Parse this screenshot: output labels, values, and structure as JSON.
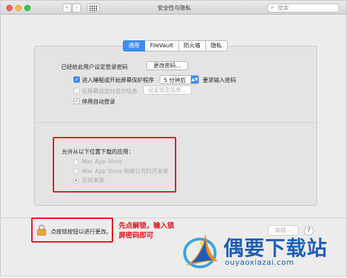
{
  "window": {
    "title": "安全性与隐私",
    "search_placeholder": "搜索",
    "grid_icon": "grid-icon"
  },
  "tabs": [
    {
      "label": "通用",
      "active": true
    },
    {
      "label": "FileVault",
      "active": false
    },
    {
      "label": "防火墙",
      "active": false
    },
    {
      "label": "隐私",
      "active": false
    }
  ],
  "general": {
    "login_password_label": "已经给此用户设定登录密码",
    "change_password_button": "更改密码...",
    "require_password": {
      "label": "进入睡眠或开始屏幕保护程序",
      "checked": true,
      "delay": "5 分钟后",
      "suffix": "要求输入密码"
    },
    "show_message": {
      "label": "在屏幕锁定时显示信息",
      "checked": false,
      "button": "设定锁定信息..."
    },
    "disable_auto_login": {
      "label": "停用自动登录",
      "checked": true
    }
  },
  "downloads": {
    "title": "允许从以下位置下载的应用：",
    "options": [
      {
        "label": "Mac App Store",
        "selected": false
      },
      {
        "label": "Mac App Store 和被认可的开发者",
        "selected": false
      },
      {
        "label": "任何来源",
        "selected": true
      }
    ]
  },
  "footer": {
    "lock_text": "点按锁按钮以进行更改。",
    "advanced_button": "高级...",
    "help_button": "?"
  },
  "annotation": {
    "line1": "先点解锁，输入锁",
    "line2": "屏密码即可"
  },
  "watermark": {
    "name": "偶要下载站",
    "url": "ouyaoxiazai.com"
  },
  "colors": {
    "accent": "#3a8ff4",
    "annotation_red": "#e0141b",
    "logo_blue": "#1f5db8"
  }
}
